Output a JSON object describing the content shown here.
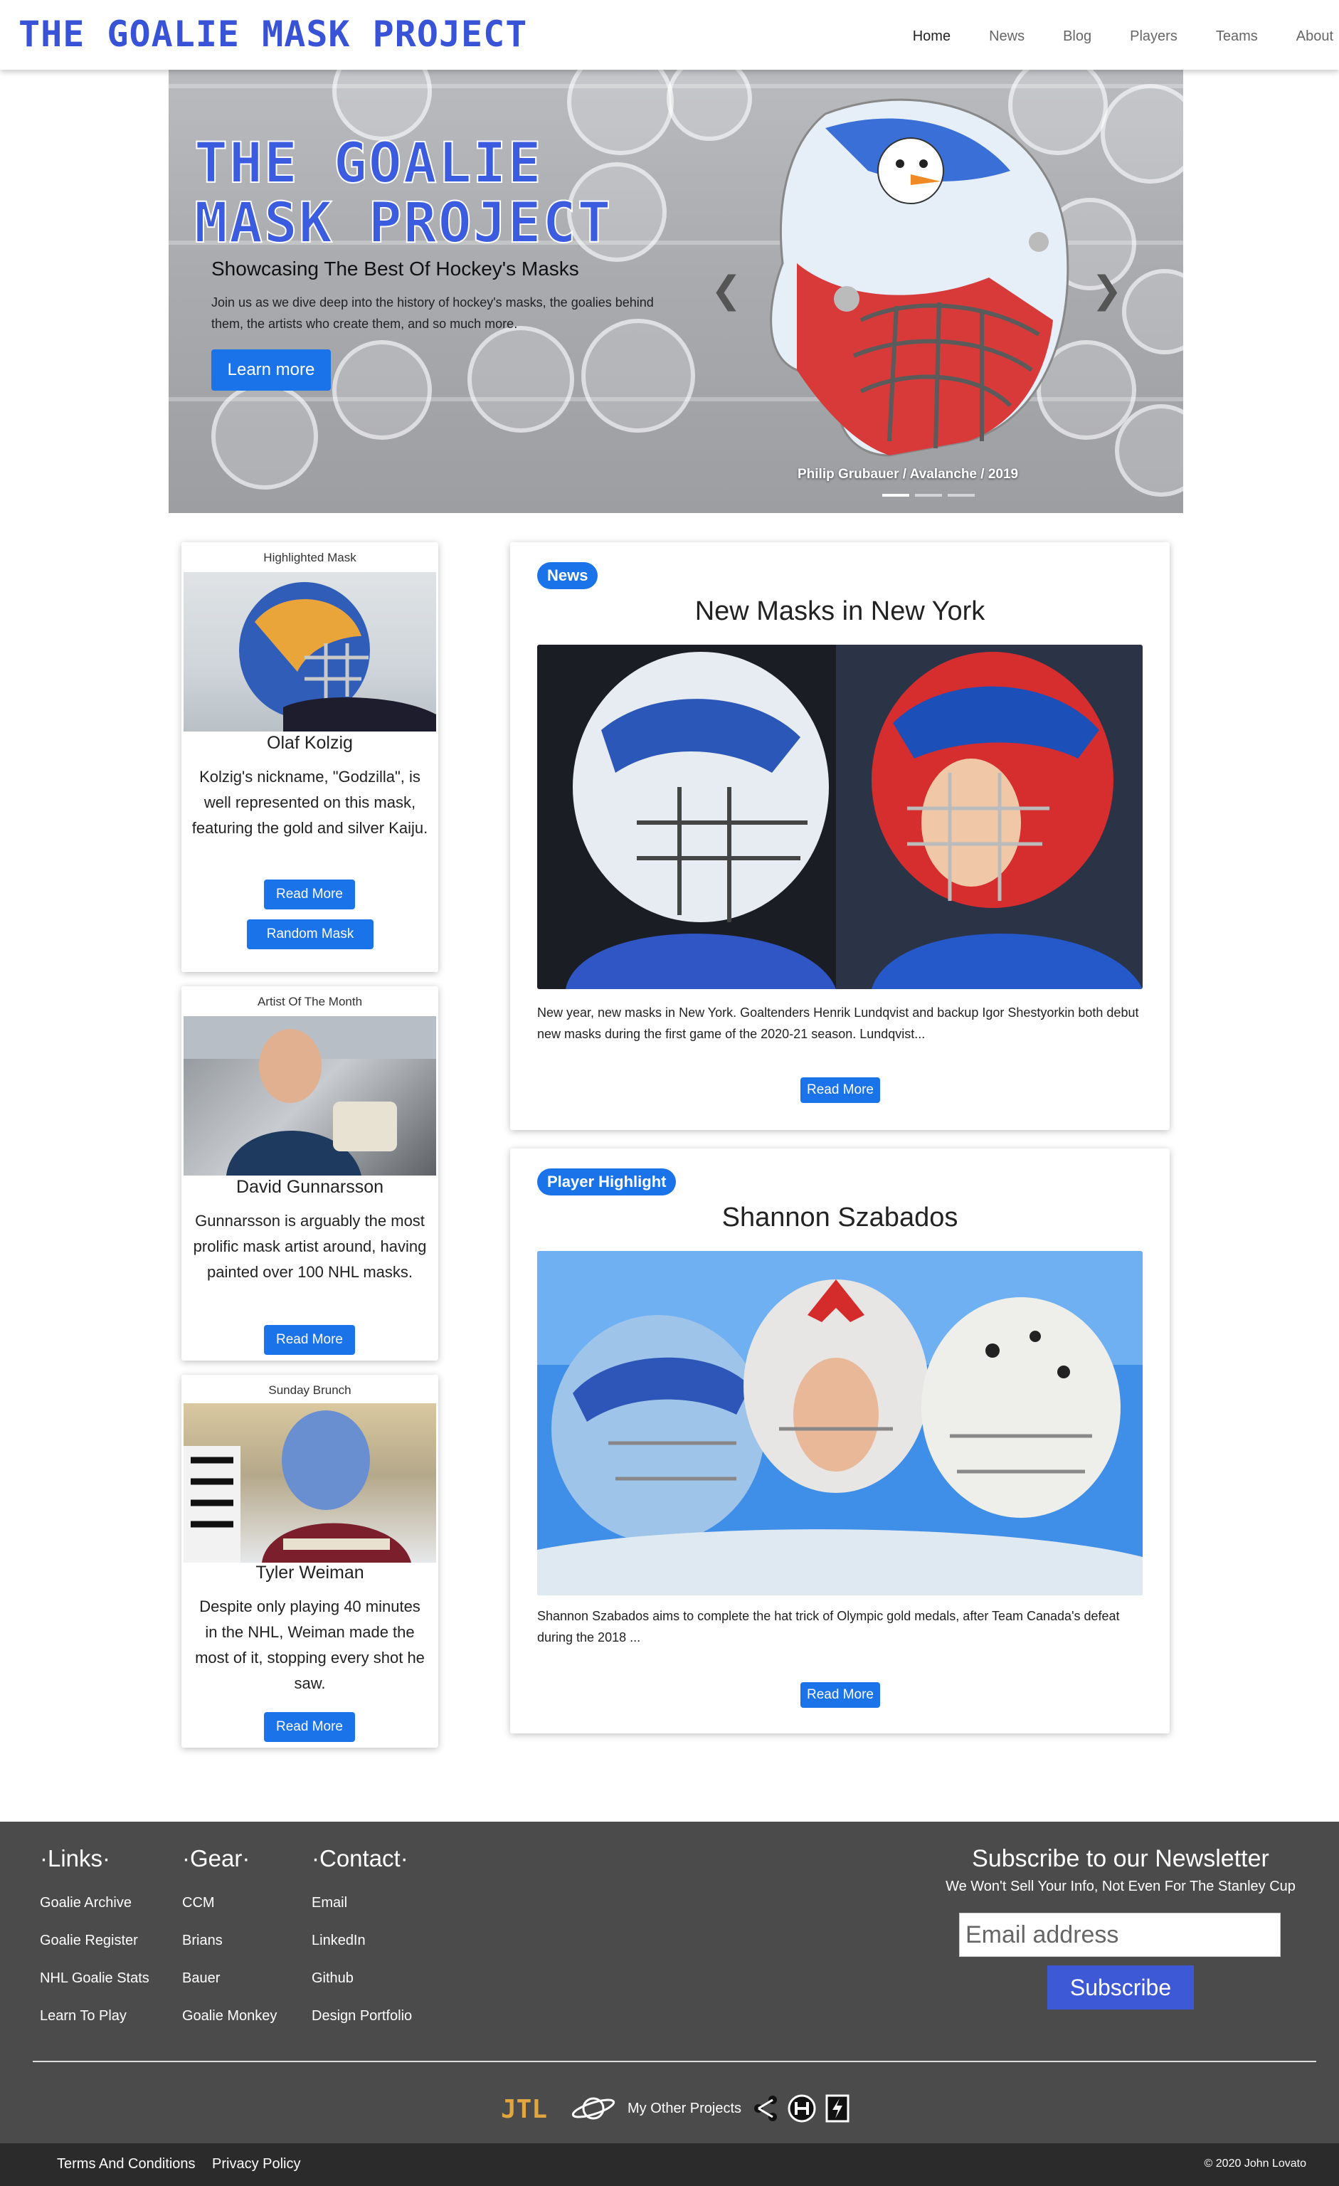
{
  "navbar": {
    "brand": "The Goalie Mask Project",
    "links": [
      "Home",
      "News",
      "Blog",
      "Players",
      "Teams",
      "About"
    ]
  },
  "hero": {
    "title": "THE GOALIE MASK PROJECT",
    "subtitle": "Showcasing The Best Of Hockey's Masks",
    "description": "Join us as we dive deep into the history of hockey's masks, the goalies behind them, the artists who create them, and so much more.",
    "button": "Learn more",
    "caption": "Philip Grubauer / Avalanche / 2019",
    "prev_icon": "chevron-left-icon",
    "next_icon": "chevron-right-icon"
  },
  "sidebar": [
    {
      "label": "Highlighted Mask",
      "name": "Olaf Kolzig",
      "text": "Kolzig's nickname, \"Godzilla\", is well represented on this mask, featuring the gold and silver Kaiju.",
      "button": "Read More",
      "button2": "Random Mask"
    },
    {
      "label": "Artist Of The Month",
      "name": "David Gunnarsson",
      "text": "Gunnarsson is arguably the most prolific mask artist around, having painted over 100 NHL masks.",
      "button": "Read More"
    },
    {
      "label": "Sunday Brunch",
      "name": "Tyler Weiman",
      "text": "Despite only playing 40 minutes in the NHL, Weiman made the most of it, stopping every shot he saw.",
      "button": "Read More"
    }
  ],
  "articles": [
    {
      "badge": "News",
      "title": "New Masks in New York",
      "excerpt": "New year, new masks in New York. Goaltenders Henrik Lundqvist and backup Igor Shestyorkin both debut new masks during the first game of the 2020-21 season. Lundqvist...",
      "button": "Read More"
    },
    {
      "badge": "Player Highlight",
      "title": "Shannon Szabados",
      "excerpt": "Shannon Szabados aims to complete the hat trick of Olympic gold medals, after Team Canada's defeat during the 2018 ...",
      "button": "Read More"
    }
  ],
  "footer": {
    "links": {
      "title": "Links",
      "items": [
        "Goalie Archive",
        "Goalie Register",
        "NHL Goalie Stats",
        "Learn To Play"
      ]
    },
    "gear": {
      "title": "Gear",
      "items": [
        "CCM",
        "Brians",
        "Bauer",
        "Goalie Monkey"
      ]
    },
    "contact": {
      "title": "Contact",
      "items": [
        "Email",
        "LinkedIn",
        "Github",
        "Design Portfolio"
      ]
    },
    "newsletter": {
      "title": "Subscribe to our Newsletter",
      "note": "We Won't Sell Your Info, Not Even For The Stanley Cup",
      "placeholder": "Email address",
      "button": "Subscribe"
    },
    "projects": {
      "logo": "JTL",
      "other": "My Other Projects"
    },
    "terms": "Terms And Conditions",
    "privacy": "Privacy Policy",
    "copyright": "© 2020 John Lovato"
  },
  "colors": {
    "brand": "#3853d6",
    "primary": "#1a73e8",
    "footer": "#4b4b4b",
    "bottom_bar": "#2b2b2b",
    "subscribe": "#3d59d6"
  }
}
